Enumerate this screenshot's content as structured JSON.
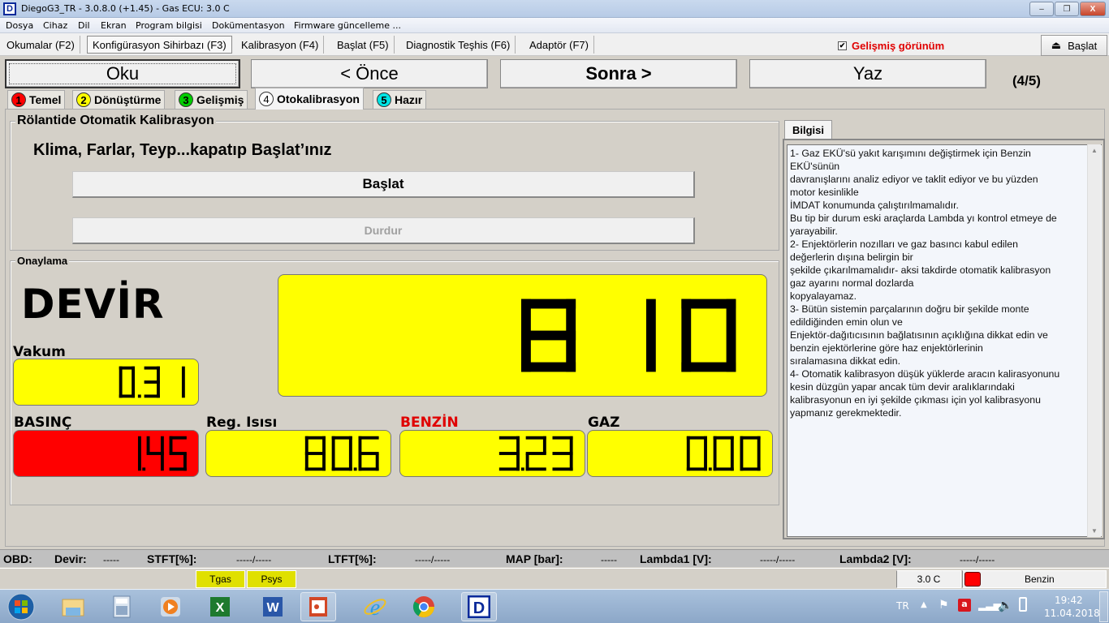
{
  "window": {
    "title": "DiegoG3_TR - 3.0.8.0 (+1.45) - Gas ECU: 3.0 C",
    "app_icon_letter": "D",
    "controls": {
      "minimize": "–",
      "restore": "❐",
      "close": "X"
    }
  },
  "menu": [
    "Dosya",
    "Cihaz",
    "Dil",
    "Ekran",
    "Program bilgisi",
    "Dokümentasyon",
    "Firmware güncelleme ..."
  ],
  "toolbar": {
    "tabs": [
      {
        "label": "Okumalar (F2)",
        "active": false
      },
      {
        "label": "Konfigürasyon Sihirbazı (F3)",
        "active": true
      },
      {
        "label": "Kalibrasyon (F4)",
        "active": false
      },
      {
        "label": "Başlat (F5)",
        "active": false
      },
      {
        "label": "Diagnostik Teşhis (F6)",
        "active": false
      },
      {
        "label": "Adaptör (F7)",
        "active": false
      }
    ],
    "advanced_view_label": "Gelişmiş görünüm",
    "advanced_view_checked": true,
    "checkmark": "✔",
    "start_button": {
      "icon": "⏏",
      "label": "Başlat"
    }
  },
  "wizard": {
    "read_label": "Oku",
    "prev_label": "< Önce",
    "next_label": "Sonra >",
    "write_label": "Yaz",
    "step_counter": "(4/5)",
    "steps": [
      {
        "num": "1",
        "label": "Temel",
        "color": "#ff0000",
        "active": false
      },
      {
        "num": "2",
        "label": "Dönüştürme",
        "color": "#ffff00",
        "active": false
      },
      {
        "num": "3",
        "label": "Gelişmiş",
        "color": "#00cc00",
        "active": false
      },
      {
        "num": "4",
        "label": "Otokalibrasyon",
        "color": "#ffffff",
        "active": true
      },
      {
        "num": "5",
        "label": "Hazır",
        "color": "#00e5e5",
        "active": false
      }
    ]
  },
  "autocal": {
    "group_title": "Rölantide Otomatik Kalibrasyon",
    "instruction": "Klima, Farlar, Teyp...kapatıp Başlat’ınız",
    "start_label": "Başlat",
    "stop_label": "Durdur"
  },
  "confirm": {
    "group_title": "Onaylama",
    "rpm_label": "DEVİR",
    "rpm_value": "810",
    "vacuum_label": "Vakum",
    "vacuum_value": "0.31",
    "pressure_label": "BASINÇ",
    "pressure_value": "1.45",
    "reg_temp_label": "Reg. Isısı",
    "reg_temp_value": "80.6",
    "petrol_label": "BENZİN",
    "petrol_value": "3.23",
    "gas_label": "GAZ",
    "gas_value": "0.00",
    "colors": {
      "lcd": "#ffff00",
      "alarm": "#ff0000",
      "petrol_label": "#e00000"
    }
  },
  "info": {
    "tab_label": "Bilgisi",
    "text": "1- Gaz EKÜ'sü yakıt karışımını değiştirmek için Benzin\nEKÜ'sünün\ndavranışlarını analiz ediyor ve taklit ediyor ve bu yüzden\nmotor kesinlikle\nİMDAT konumunda çalıştırılmamalıdır.\nBu tip bir durum eski araçlarda Lambda yı kontrol etmeye de\nyarayabilir.\n2- Enjektörlerin nozılları ve gaz basıncı kabul edilen\ndeğerlerin dışına belirgin bir\nşekilde çıkarılmamalıdır- aksi takdirde otomatik kalibrasyon\ngaz ayarını normal dozlarda\nkopyalayamaz.\n3- Bütün sistemin parçalarının doğru bir şekilde monte\nedildiğinden emin olun ve\nEnjektör-dağıtıcısının bağlatısının açıklığına dikkat edin ve\nbenzin ejektörlerine göre haz enjektörlerinin\nsıralamasına dikkat edin.\n4- Otomatik kalibrasyon düşük yüklerde aracın kalirasyonunu\nkesin düzgün yapar ancak tüm devir aralıklarındaki\nkalibrasyonun en iyi şekilde çıkması için yol kalibrasyonu\nyapmanız gerekmektedir."
  },
  "obd": {
    "obd_label": "OBD:",
    "rpm_label": "Devir:",
    "rpm_value": "-----",
    "stft_label": "STFT[%]:",
    "stft_value": "-----/-----",
    "ltft_label": "LTFT[%]:",
    "ltft_value": "-----/-----",
    "map_label": "MAP [bar]:",
    "map_value": "-----",
    "lambda1_label": "Lambda1 [V]:",
    "lambda1_value": "-----/-----",
    "lambda2_label": "Lambda2 [V]:",
    "lambda2_value": "-----/-----"
  },
  "status": {
    "tgas": "Tgas",
    "psys": "Psys",
    "ecu_version": "3.0 C",
    "fuel_mode": "Benzin",
    "fuel_indicator_color": "#ff0000"
  },
  "taskbar": {
    "apps": [
      "start-orb",
      "file-explorer",
      "calculator",
      "media-player",
      "excel",
      "word",
      "powerpoint",
      "internet-explorer",
      "chrome",
      "diego"
    ],
    "language": "TR",
    "time": "19:42",
    "date": "11.04.2018"
  }
}
